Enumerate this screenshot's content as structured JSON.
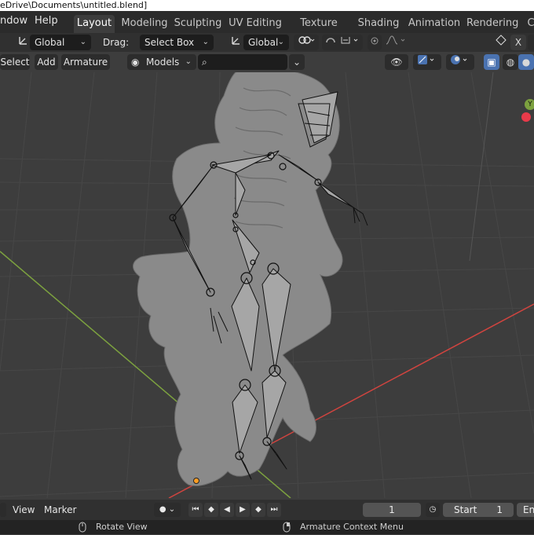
{
  "window": {
    "title": "eDrive\\Documents\\untitled.blend]"
  },
  "menubar": {
    "items": [
      "ndow",
      "Help"
    ],
    "workspaces": [
      {
        "label": "Layout",
        "active": true
      },
      {
        "label": "Modeling",
        "active": false
      },
      {
        "label": "Sculpting",
        "active": false
      },
      {
        "label": "UV Editing",
        "active": false
      },
      {
        "label": "Texture Paint",
        "active": false
      },
      {
        "label": "Shading",
        "active": false
      },
      {
        "label": "Animation",
        "active": false
      },
      {
        "label": "Rendering",
        "active": false
      },
      {
        "label": "C",
        "active": false
      }
    ]
  },
  "header": {
    "orientation_value": "Global",
    "drag_label": "Drag:",
    "drag_value": "Select Box",
    "pivot_value": "Global",
    "close_label": "X"
  },
  "toolbar": {
    "select": "Select",
    "add": "Add",
    "armature": "Armature",
    "collection": "Models",
    "search_placeholder": ""
  },
  "gizmo": {
    "y_label": "Y"
  },
  "timeline": {
    "view": "View",
    "marker": "Marker",
    "current_frame": "1",
    "start_label": "Start",
    "start_value": "1",
    "end_label": "En"
  },
  "status": {
    "left_hint": "Rotate View",
    "right_hint": "Armature Context Menu"
  },
  "colors": {
    "accent": "#4a72b0",
    "x_axis": "#d0443f",
    "y_axis": "#7ca13f",
    "background": "#3d3d3d"
  }
}
